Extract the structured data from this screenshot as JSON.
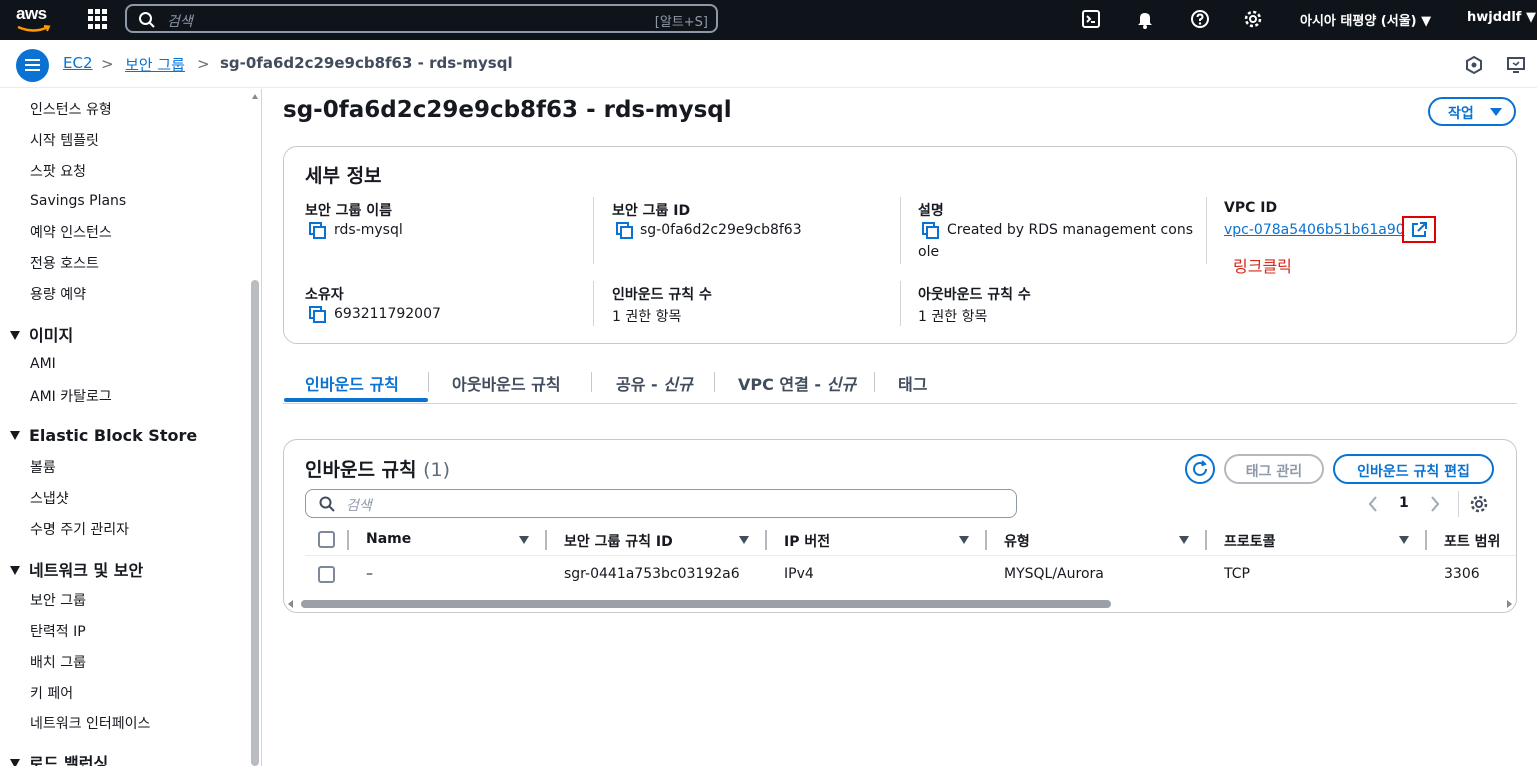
{
  "topbar": {
    "logo_text": "aws",
    "search_placeholder": "검색",
    "search_shortcut": "[알트+S]",
    "region": "아시아 태평양 (서울)",
    "user": "hwjddlf",
    "icons": [
      "apps-grid-icon",
      "search-icon",
      "cloudshell-icon",
      "bell-icon",
      "help-icon",
      "gear-icon"
    ]
  },
  "breadcrumb": {
    "items": [
      "EC2",
      "보안 그룹",
      "sg-0fa6d2c29e9cb8f63 - rds-mysql"
    ],
    "separator": ">"
  },
  "sidebar": {
    "groups": [
      {
        "items": [
          "인스턴스 유형",
          "시작 템플릿",
          "스팟 요청",
          "Savings Plans",
          "예약 인스턴스",
          "전용 호스트",
          "용량 예약"
        ]
      },
      {
        "heading": "이미지",
        "items": [
          "AMI",
          "AMI 카탈로그"
        ]
      },
      {
        "heading": "Elastic Block Store",
        "items": [
          "볼륨",
          "스냅샷",
          "수명 주기 관리자"
        ]
      },
      {
        "heading": "네트워크 및 보안",
        "items": [
          "보안 그룹",
          "탄력적 IP",
          "배치 그룹",
          "키 페어",
          "네트워크 인터페이스"
        ]
      },
      {
        "heading": "로드 밸런싱"
      }
    ]
  },
  "page": {
    "title": "sg-0fa6d2c29e9cb8f63 - rds-mysql",
    "actions_label": "작업"
  },
  "details": {
    "title": "세부 정보",
    "fields": [
      {
        "label": "보안 그룹 이름",
        "value": "rds-mysql"
      },
      {
        "label": "보안 그룹 ID",
        "value": "sg-0fa6d2c29e9cb8f63"
      },
      {
        "label": "설명",
        "value_line1": "Created by RDS management cons",
        "value_line2": "ole"
      },
      {
        "label": "VPC ID",
        "value": "vpc-078a5406b51b61a90"
      },
      {
        "label": "소유자",
        "value": "693211792007"
      },
      {
        "label": "인바운드 규칙 수",
        "value": "1 권한 항목"
      },
      {
        "label": "아웃바운드 규칙 수",
        "value": "1 권한 항목"
      }
    ],
    "annotation": "링크클릭",
    "annotation_color": "#d5281b"
  },
  "tabs": [
    {
      "label": "인바운드 규칙"
    },
    {
      "label": "아웃바운드 규칙"
    },
    {
      "label": "공유 - ",
      "italic": "신규"
    },
    {
      "label": "VPC 연결 - ",
      "italic": "신규"
    },
    {
      "label": "태그"
    }
  ],
  "inbound": {
    "title": "인바운드 규칙",
    "count": "(1)",
    "tag_button": "태그 관리",
    "edit_button": "인바운드 규칙 편집",
    "filter_placeholder": "검색",
    "page_number": "1",
    "columns": [
      "Name",
      "보안 그룹 규칙 ID",
      "IP 버전",
      "유형",
      "프로토콜",
      "포트 범위"
    ],
    "rows": [
      [
        "–",
        "sgr-0441a753bc03192a6",
        "IPv4",
        "MYSQL/Aurora",
        "TCP",
        "3306"
      ]
    ]
  },
  "colors": {
    "accent": "#0972d3",
    "topbar": "#0f141a",
    "highlight_box": "#e00000"
  }
}
